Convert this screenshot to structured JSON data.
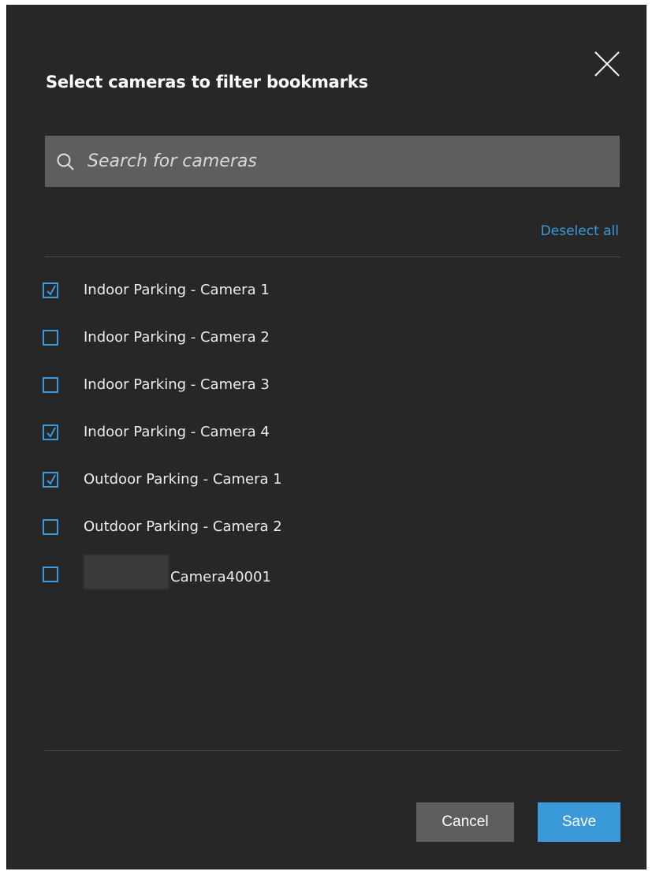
{
  "dialog": {
    "title": "Select cameras to filter bookmarks",
    "close_icon": "close-icon"
  },
  "search": {
    "placeholder": "Search for cameras",
    "value": "",
    "icon": "search-icon"
  },
  "deselect_all_label": "Deselect all",
  "cameras": [
    {
      "label": "Indoor Parking - Camera 1",
      "checked": true
    },
    {
      "label": "Indoor Parking - Camera 2",
      "checked": false
    },
    {
      "label": "Indoor Parking - Camera 3",
      "checked": false
    },
    {
      "label": "Indoor Parking - Camera 4",
      "checked": true
    },
    {
      "label": "Outdoor Parking - Camera 1",
      "checked": true
    },
    {
      "label": "Outdoor Parking - Camera 2",
      "checked": false
    },
    {
      "label": "Camera40001",
      "checked": false,
      "redacted_prefix": true
    }
  ],
  "buttons": {
    "cancel_label": "Cancel",
    "save_label": "Save"
  },
  "colors": {
    "background": "#272727",
    "accent": "#3a9ad9",
    "search_bg": "#5e5e5e",
    "cancel_bg": "#5e5e5e"
  }
}
